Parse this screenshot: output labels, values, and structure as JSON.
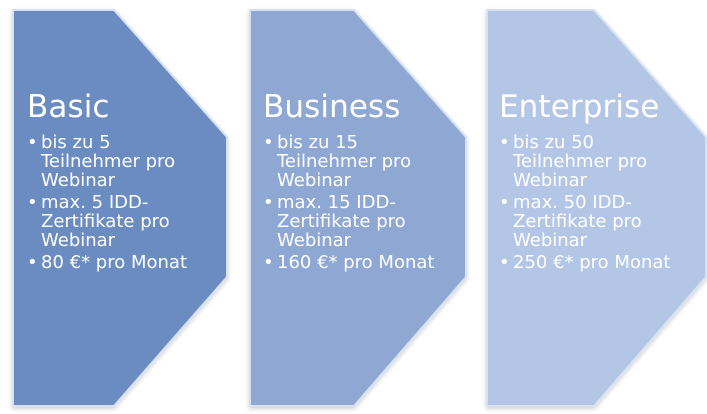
{
  "theme": {
    "basic_fill": "#6b8cc1",
    "business_fill": "#8ea8d3",
    "enterprise_fill": "#b3c6e6",
    "edge": "#d7e1f1",
    "text": "#ffffff"
  },
  "cards": [
    {
      "title": "Basic",
      "bullets": [
        "bis zu 5\nTeilnehmer pro\nWebinar",
        "max. 5 IDD-\nZertifikate pro\nWebinar",
        "80 €* pro Monat"
      ]
    },
    {
      "title": "Business",
      "bullets": [
        "bis zu 15\nTeilnehmer pro\nWebinar",
        "max. 15 IDD-\nZertifikate pro\nWebinar",
        "160 €* pro Monat"
      ]
    },
    {
      "title": "Enterprise",
      "bullets": [
        "bis zu 50\nTeilnehmer pro\nWebinar",
        "max. 50 IDD-\nZertifikate pro\nWebinar",
        "250 €* pro Monat"
      ]
    }
  ]
}
